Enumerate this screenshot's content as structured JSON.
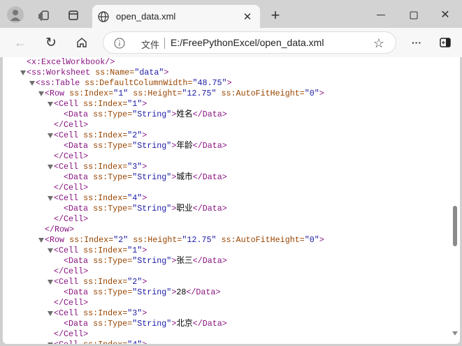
{
  "tab": {
    "title": "open_data.xml",
    "icon": "globe-icon"
  },
  "address": {
    "label": "文件",
    "url": "E:/FreePythonExcel/open_data.xml"
  },
  "colors": {
    "tag": "#881280",
    "attr_name": "#994500",
    "attr_value": "#1a1aa6"
  },
  "xml_lines": [
    {
      "level": 0,
      "toggle": false,
      "tokens": [
        [
          "tag",
          "<x:ExcelWorkbook/>"
        ]
      ]
    },
    {
      "level": 0,
      "toggle": true,
      "tokens": [
        [
          "tag",
          "<ss:Worksheet "
        ],
        [
          "an",
          "ss:Name="
        ],
        [
          "av",
          "\"data\""
        ],
        [
          "tag",
          ">"
        ]
      ]
    },
    {
      "level": 1,
      "toggle": true,
      "tokens": [
        [
          "tag",
          "<ss:Table "
        ],
        [
          "an",
          "ss:DefaultColumnWidth="
        ],
        [
          "av",
          "\"48.75\""
        ],
        [
          "tag",
          ">"
        ]
      ]
    },
    {
      "level": 2,
      "toggle": true,
      "tokens": [
        [
          "tag",
          "<Row "
        ],
        [
          "an",
          "ss:Index="
        ],
        [
          "av",
          "\"1\" "
        ],
        [
          "an",
          "ss:Height="
        ],
        [
          "av",
          "\"12.75\" "
        ],
        [
          "an",
          "ss:AutoFitHeight="
        ],
        [
          "av",
          "\"0\""
        ],
        [
          "tag",
          ">"
        ]
      ]
    },
    {
      "level": 3,
      "toggle": true,
      "tokens": [
        [
          "tag",
          "<Cell "
        ],
        [
          "an",
          "ss:Index="
        ],
        [
          "av",
          "\"1\""
        ],
        [
          "tag",
          ">"
        ]
      ]
    },
    {
      "level": 4,
      "toggle": false,
      "tokens": [
        [
          "tag",
          "<Data "
        ],
        [
          "an",
          "ss:Type="
        ],
        [
          "av",
          "\"String\""
        ],
        [
          "tag",
          ">"
        ],
        [
          "tx",
          "姓名"
        ],
        [
          "tag",
          "</Data>"
        ]
      ]
    },
    {
      "level": 3,
      "toggle": false,
      "tokens": [
        [
          "tag",
          "</Cell>"
        ]
      ]
    },
    {
      "level": 3,
      "toggle": true,
      "tokens": [
        [
          "tag",
          "<Cell "
        ],
        [
          "an",
          "ss:Index="
        ],
        [
          "av",
          "\"2\""
        ],
        [
          "tag",
          ">"
        ]
      ]
    },
    {
      "level": 4,
      "toggle": false,
      "tokens": [
        [
          "tag",
          "<Data "
        ],
        [
          "an",
          "ss:Type="
        ],
        [
          "av",
          "\"String\""
        ],
        [
          "tag",
          ">"
        ],
        [
          "tx",
          "年龄"
        ],
        [
          "tag",
          "</Data>"
        ]
      ]
    },
    {
      "level": 3,
      "toggle": false,
      "tokens": [
        [
          "tag",
          "</Cell>"
        ]
      ]
    },
    {
      "level": 3,
      "toggle": true,
      "tokens": [
        [
          "tag",
          "<Cell "
        ],
        [
          "an",
          "ss:Index="
        ],
        [
          "av",
          "\"3\""
        ],
        [
          "tag",
          ">"
        ]
      ]
    },
    {
      "level": 4,
      "toggle": false,
      "tokens": [
        [
          "tag",
          "<Data "
        ],
        [
          "an",
          "ss:Type="
        ],
        [
          "av",
          "\"String\""
        ],
        [
          "tag",
          ">"
        ],
        [
          "tx",
          "城市"
        ],
        [
          "tag",
          "</Data>"
        ]
      ]
    },
    {
      "level": 3,
      "toggle": false,
      "tokens": [
        [
          "tag",
          "</Cell>"
        ]
      ]
    },
    {
      "level": 3,
      "toggle": true,
      "tokens": [
        [
          "tag",
          "<Cell "
        ],
        [
          "an",
          "ss:Index="
        ],
        [
          "av",
          "\"4\""
        ],
        [
          "tag",
          ">"
        ]
      ]
    },
    {
      "level": 4,
      "toggle": false,
      "tokens": [
        [
          "tag",
          "<Data "
        ],
        [
          "an",
          "ss:Type="
        ],
        [
          "av",
          "\"String\""
        ],
        [
          "tag",
          ">"
        ],
        [
          "tx",
          "职业"
        ],
        [
          "tag",
          "</Data>"
        ]
      ]
    },
    {
      "level": 3,
      "toggle": false,
      "tokens": [
        [
          "tag",
          "</Cell>"
        ]
      ]
    },
    {
      "level": 2,
      "toggle": false,
      "tokens": [
        [
          "tag",
          "</Row>"
        ]
      ]
    },
    {
      "level": 2,
      "toggle": true,
      "tokens": [
        [
          "tag",
          "<Row "
        ],
        [
          "an",
          "ss:Index="
        ],
        [
          "av",
          "\"2\" "
        ],
        [
          "an",
          "ss:Height="
        ],
        [
          "av",
          "\"12.75\" "
        ],
        [
          "an",
          "ss:AutoFitHeight="
        ],
        [
          "av",
          "\"0\""
        ],
        [
          "tag",
          ">"
        ]
      ]
    },
    {
      "level": 3,
      "toggle": true,
      "tokens": [
        [
          "tag",
          "<Cell "
        ],
        [
          "an",
          "ss:Index="
        ],
        [
          "av",
          "\"1\""
        ],
        [
          "tag",
          ">"
        ]
      ]
    },
    {
      "level": 4,
      "toggle": false,
      "tokens": [
        [
          "tag",
          "<Data "
        ],
        [
          "an",
          "ss:Type="
        ],
        [
          "av",
          "\"String\""
        ],
        [
          "tag",
          ">"
        ],
        [
          "tx",
          "张三"
        ],
        [
          "tag",
          "</Data>"
        ]
      ]
    },
    {
      "level": 3,
      "toggle": false,
      "tokens": [
        [
          "tag",
          "</Cell>"
        ]
      ]
    },
    {
      "level": 3,
      "toggle": true,
      "tokens": [
        [
          "tag",
          "<Cell "
        ],
        [
          "an",
          "ss:Index="
        ],
        [
          "av",
          "\"2\""
        ],
        [
          "tag",
          ">"
        ]
      ]
    },
    {
      "level": 4,
      "toggle": false,
      "tokens": [
        [
          "tag",
          "<Data "
        ],
        [
          "an",
          "ss:Type="
        ],
        [
          "av",
          "\"String\""
        ],
        [
          "tag",
          ">"
        ],
        [
          "tx",
          "28"
        ],
        [
          "tag",
          "</Data>"
        ]
      ]
    },
    {
      "level": 3,
      "toggle": false,
      "tokens": [
        [
          "tag",
          "</Cell>"
        ]
      ]
    },
    {
      "level": 3,
      "toggle": true,
      "tokens": [
        [
          "tag",
          "<Cell "
        ],
        [
          "an",
          "ss:Index="
        ],
        [
          "av",
          "\"3\""
        ],
        [
          "tag",
          ">"
        ]
      ]
    },
    {
      "level": 4,
      "toggle": false,
      "tokens": [
        [
          "tag",
          "<Data "
        ],
        [
          "an",
          "ss:Type="
        ],
        [
          "av",
          "\"String\""
        ],
        [
          "tag",
          ">"
        ],
        [
          "tx",
          "北京"
        ],
        [
          "tag",
          "</Data>"
        ]
      ]
    },
    {
      "level": 3,
      "toggle": false,
      "tokens": [
        [
          "tag",
          "</Cell>"
        ]
      ]
    },
    {
      "level": 3,
      "toggle": true,
      "tokens": [
        [
          "tag",
          "<Cell "
        ],
        [
          "an",
          "ss:Index="
        ],
        [
          "av",
          "\"4\""
        ],
        [
          "tag",
          ">"
        ]
      ]
    }
  ]
}
